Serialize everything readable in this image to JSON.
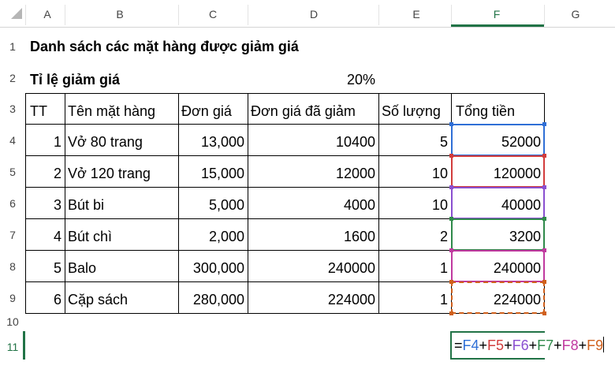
{
  "columns": [
    "A",
    "B",
    "C",
    "D",
    "E",
    "F",
    "G"
  ],
  "rows": [
    "1",
    "2",
    "3",
    "4",
    "5",
    "6",
    "7",
    "8",
    "9",
    "10",
    "11"
  ],
  "sheet": {
    "title": "Danh sách các mặt hàng được giảm giá",
    "discount_label": "Tỉ lệ giảm giá",
    "discount_value": "20%",
    "headers": {
      "tt": "TT",
      "name": "Tên mặt hàng",
      "unit_price": "Đơn giá",
      "discounted_price": "Đơn giá đã giảm",
      "quantity": "Số lượng",
      "total": "Tổng tiền"
    },
    "items": [
      {
        "tt": "1",
        "name": "Vở 80 trang",
        "unit_price": "13,000",
        "discounted_price": "10400",
        "quantity": "5",
        "total": "52000"
      },
      {
        "tt": "2",
        "name": "Vở 120 trang",
        "unit_price": "15,000",
        "discounted_price": "12000",
        "quantity": "10",
        "total": "120000"
      },
      {
        "tt": "3",
        "name": "Bút bi",
        "unit_price": "5,000",
        "discounted_price": "4000",
        "quantity": "10",
        "total": "40000"
      },
      {
        "tt": "4",
        "name": "Bút chì",
        "unit_price": "2,000",
        "discounted_price": "1600",
        "quantity": "2",
        "total": "3200"
      },
      {
        "tt": "5",
        "name": "Balo",
        "unit_price": "300,000",
        "discounted_price": "240000",
        "quantity": "1",
        "total": "240000"
      },
      {
        "tt": "6",
        "name": "Cặp sách",
        "unit_price": "280,000",
        "discounted_price": "224000",
        "quantity": "1",
        "total": "224000"
      }
    ],
    "formula_parts": [
      {
        "text": "=",
        "color": "#000000"
      },
      {
        "text": "F4",
        "color": "#2f6fd6"
      },
      {
        "text": "+",
        "color": "#000000"
      },
      {
        "text": "F5",
        "color": "#d23c3c"
      },
      {
        "text": "+",
        "color": "#000000"
      },
      {
        "text": "F6",
        "color": "#8a4fd0"
      },
      {
        "text": "+",
        "color": "#000000"
      },
      {
        "text": "F7",
        "color": "#2f8a4a"
      },
      {
        "text": "+",
        "color": "#000000"
      },
      {
        "text": "F8",
        "color": "#c0399f"
      },
      {
        "text": "+",
        "color": "#000000"
      },
      {
        "text": "F9",
        "color": "#d0601c"
      }
    ],
    "reference_colors": [
      "#2f6fd6",
      "#d23c3c",
      "#8a4fd0",
      "#2f8a4a",
      "#c0399f",
      "#d0601c"
    ]
  }
}
